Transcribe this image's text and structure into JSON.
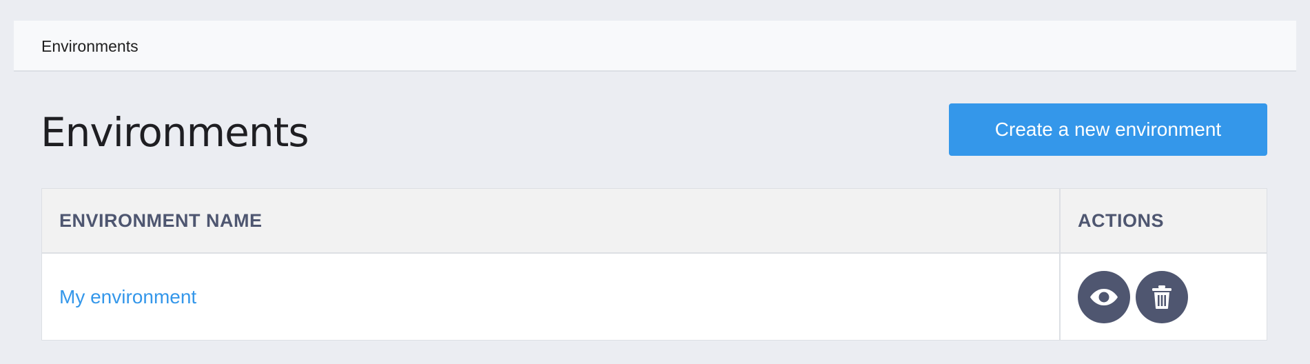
{
  "breadcrumb": {
    "label": "Environments"
  },
  "page": {
    "title": "Environments",
    "create_button_label": "Create a new environment"
  },
  "table": {
    "columns": [
      "ENVIRONMENT NAME",
      "ACTIONS"
    ],
    "rows": [
      {
        "name": "My environment",
        "actions": [
          {
            "icon": "eye-icon",
            "label": "view"
          },
          {
            "icon": "trash-icon",
            "label": "delete"
          }
        ]
      }
    ]
  },
  "colors": {
    "accent": "#3497ea",
    "action_button": "#4f5670",
    "header_text": "#4e5670",
    "background": "#ebedf2"
  }
}
